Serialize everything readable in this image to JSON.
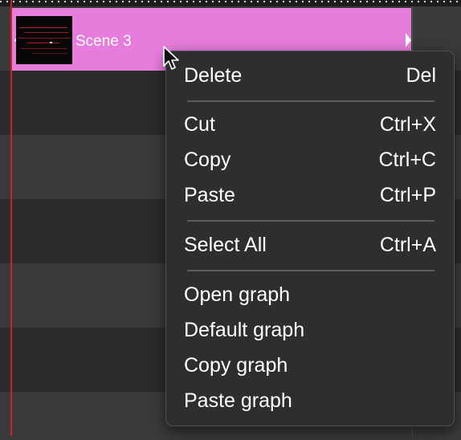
{
  "clip": {
    "label": "Scene 3",
    "color": "#e67ddd"
  },
  "playhead_color": "#d21f2a",
  "context_menu": {
    "items": [
      {
        "label": "Delete",
        "shortcut": "Del"
      },
      {
        "label": "Cut",
        "shortcut": "Ctrl+X"
      },
      {
        "label": "Copy",
        "shortcut": "Ctrl+C"
      },
      {
        "label": "Paste",
        "shortcut": "Ctrl+P"
      },
      {
        "label": "Select All",
        "shortcut": "Ctrl+A"
      },
      {
        "label": "Open graph",
        "shortcut": ""
      },
      {
        "label": "Default graph",
        "shortcut": ""
      },
      {
        "label": "Copy graph",
        "shortcut": ""
      },
      {
        "label": "Paste graph",
        "shortcut": ""
      }
    ]
  }
}
